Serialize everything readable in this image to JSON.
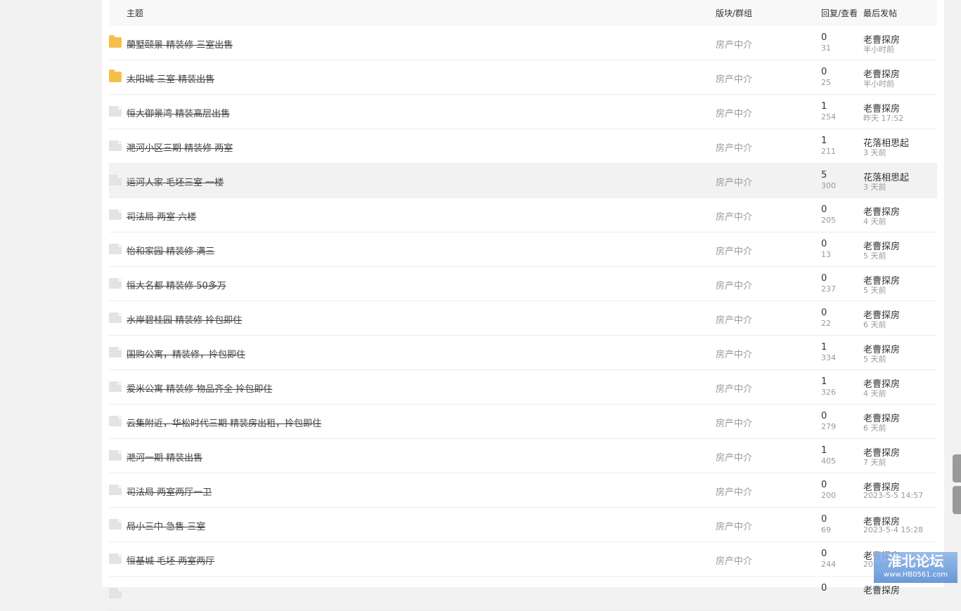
{
  "table": {
    "headers": {
      "subject": "主题",
      "forum": "版块/群组",
      "stats": "回复/查看",
      "last_post": "最后发帖"
    },
    "rows": [
      {
        "icon": "folder-yellow-icon",
        "title": "蘭墅颐景 精装修 三室出售",
        "forum": "房产中介",
        "replies": "0",
        "views": "31",
        "author": "老曹探房",
        "time": "半小时前"
      },
      {
        "icon": "folder-yellow-icon",
        "title": "太阳城 三室 精装出售",
        "forum": "房产中介",
        "replies": "0",
        "views": "25",
        "author": "老曹探房",
        "time": "半小时前"
      },
      {
        "icon": "file-gray-icon",
        "title": "恒大御景湾 精装高层出售",
        "forum": "房产中介",
        "replies": "1",
        "views": "254",
        "author": "老曹探房",
        "time": "昨天 17:52"
      },
      {
        "icon": "file-gray-icon",
        "title": "滟河小区三期 精装修 两室",
        "forum": "房产中介",
        "replies": "1",
        "views": "211",
        "author": "花落相思起",
        "time": "3 天前"
      },
      {
        "icon": "file-gray-icon",
        "title": "运河人家 毛坯三室 一楼",
        "forum": "房产中介",
        "replies": "5",
        "views": "300",
        "author": "花落相思起",
        "time": "3 天前"
      },
      {
        "icon": "file-gray-icon",
        "title": "司法局 两室 六楼",
        "forum": "房产中介",
        "replies": "0",
        "views": "205",
        "author": "老曹探房",
        "time": "4 天前"
      },
      {
        "icon": "file-gray-icon",
        "title": "怡和家园 精装修 满三",
        "forum": "房产中介",
        "replies": "0",
        "views": "13",
        "author": "老曹探房",
        "time": "5 天前"
      },
      {
        "icon": "file-gray-icon",
        "title": "恒大名都 精装修 50多万",
        "forum": "房产中介",
        "replies": "0",
        "views": "237",
        "author": "老曹探房",
        "time": "5 天前"
      },
      {
        "icon": "file-gray-icon",
        "title": "水岸碧桂园 精装修 拎包即住",
        "forum": "房产中介",
        "replies": "0",
        "views": "22",
        "author": "老曹探房",
        "time": "6 天前"
      },
      {
        "icon": "file-gray-icon",
        "title": "国购公寓，精装修，拎包即住",
        "forum": "房产中介",
        "replies": "1",
        "views": "334",
        "author": "老曹探房",
        "time": "5 天前"
      },
      {
        "icon": "file-gray-icon",
        "title": "爱米公寓 精装修 物品齐全 拎包即住",
        "forum": "房产中介",
        "replies": "1",
        "views": "326",
        "author": "老曹探房",
        "time": "4 天前"
      },
      {
        "icon": "file-gray-icon",
        "title": "云集附近，华松时代三期 精装房出租，拎包即住",
        "forum": "房产中介",
        "replies": "0",
        "views": "279",
        "author": "老曹探房",
        "time": "6 天前"
      },
      {
        "icon": "file-gray-icon",
        "title": "滟河一期 精装出售",
        "forum": "房产中介",
        "replies": "1",
        "views": "405",
        "author": "老曹探房",
        "time": "7 天前"
      },
      {
        "icon": "file-gray-icon",
        "title": "司法局 两室两厅一卫",
        "forum": "房产中介",
        "replies": "0",
        "views": "200",
        "author": "老曹探房",
        "time": "2023-5-5 14:57"
      },
      {
        "icon": "file-gray-icon",
        "title": "局小三中 急售 三室",
        "forum": "房产中介",
        "replies": "0",
        "views": "69",
        "author": "老曹探房",
        "time": "2023-5-4 15:28"
      },
      {
        "icon": "file-gray-icon",
        "title": "恒基城 毛坯 两室两厅",
        "forum": "房产中介",
        "replies": "0",
        "views": "244",
        "author": "老曹探房",
        "time": "2023-5-4 15:18"
      },
      {
        "icon": "file-gray-icon",
        "title": "",
        "forum": "",
        "replies": "0",
        "views": "",
        "author": "老曹探房",
        "time": ""
      }
    ]
  },
  "watermark": {
    "title": "淮北论坛",
    "url": "www.HB0561.com"
  }
}
